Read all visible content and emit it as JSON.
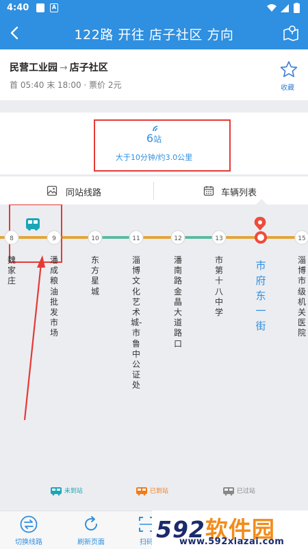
{
  "status_bar": {
    "time": "4:40",
    "badge": "A"
  },
  "header": {
    "title": "122路 开往 店子社区 方向"
  },
  "route": {
    "from": "民营工业园",
    "arrow": "→",
    "to": "店子社区",
    "schedule": "首 05:40 末 18:00 · 票价 2元",
    "favorite_label": "收藏"
  },
  "summary": {
    "stations_count": "6",
    "stations_unit": "站",
    "distance": "大于10分钟/约3.0公里"
  },
  "tabs": [
    {
      "label": "同站线路",
      "icon": "image-icon"
    },
    {
      "label": "车辆列表",
      "icon": "calendar-icon"
    }
  ],
  "stations": [
    {
      "num": "8",
      "name": "魏家庄"
    },
    {
      "num": "9",
      "name": "潘成粮油批发市场"
    },
    {
      "num": "10",
      "name": "东方星城"
    },
    {
      "num": "11",
      "name": "淄博文化艺术城-市鲁中公证处"
    },
    {
      "num": "12",
      "name": "潘南路金晶大道路口"
    },
    {
      "num": "13",
      "name": "市第十八中学"
    },
    {
      "num": "",
      "name": "市府东一街",
      "current": true
    },
    {
      "num": "15",
      "name": "淄博市级机关医院"
    }
  ],
  "legend": [
    {
      "label": "未到站",
      "color": "#1aa6b7"
    },
    {
      "label": "已到站",
      "color": "#f07c1a"
    },
    {
      "label": "已过站",
      "color": "#888888"
    }
  ],
  "bottom_bar": [
    {
      "label": "切换线路",
      "icon": "switch-icon"
    },
    {
      "label": "刷新页面",
      "icon": "refresh-icon"
    },
    {
      "label": "扫码",
      "icon": "scan-icon"
    }
  ],
  "watermark": {
    "brand_number": "592",
    "brand_text": "软件园",
    "url": "www.592xiazai.com"
  },
  "colors": {
    "primary": "#2f8fe0",
    "line_orange": "#e3a53a",
    "line_teal": "#5bb9a0",
    "highlight_red": "#e53935"
  }
}
